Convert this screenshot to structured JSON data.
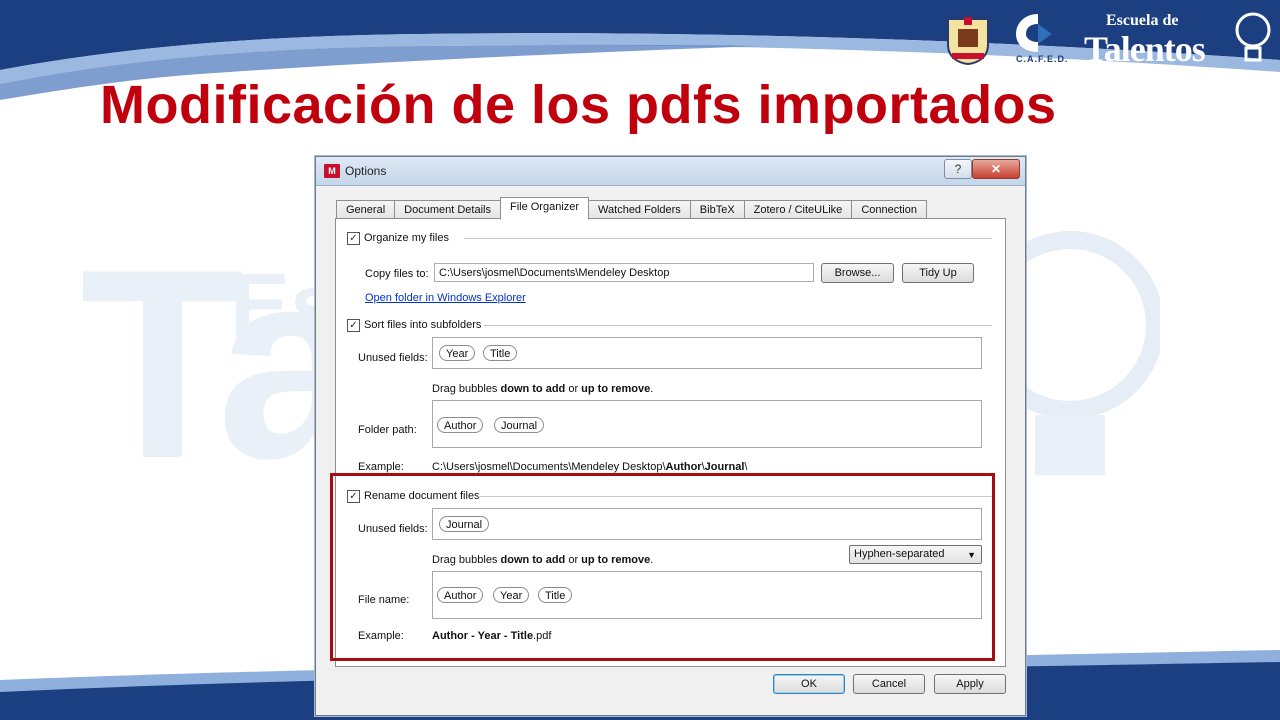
{
  "slide": {
    "title": "Modificación de los pdfs importados",
    "watermark": "Ta",
    "watermark_small": "Es",
    "logos": {
      "cafed_caption": "C.A.F.E.D.",
      "talentos_top": "Escuela de",
      "talentos_main": "Talentos"
    }
  },
  "dialog": {
    "title": "Options",
    "app_icon": "mendeley-icon",
    "help_label": "?",
    "close_label": "✕",
    "tabs": [
      "General",
      "Document Details",
      "File Organizer",
      "Watched Folders",
      "BibTeX",
      "Zotero / CiteULike",
      "Connection"
    ],
    "active_tab": "File Organizer",
    "organize": {
      "checkbox_label": "Organize my files",
      "checked": true,
      "copy_label": "Copy files to:",
      "copy_value": "C:\\Users\\josmel\\Documents\\Mendeley Desktop",
      "browse_label": "Browse...",
      "tidy_label": "Tidy Up",
      "open_folder_link": "Open folder in Windows Explorer"
    },
    "sort": {
      "checkbox_label": "Sort files into subfolders",
      "checked": true,
      "unused_label": "Unused fields:",
      "unused_bubbles": [
        "Year",
        "Title"
      ],
      "drag_hint_pre": "Drag bubbles ",
      "drag_hint_add": "down to add",
      "drag_hint_mid": " or ",
      "drag_hint_remove": "up to remove",
      "drag_hint_end": ".",
      "folder_label": "Folder path:",
      "folder_bubbles": [
        "Author",
        "Journal"
      ],
      "example_label": "Example:",
      "example_prefix": "C:\\Users\\josmel\\Documents\\Mendeley Desktop\\",
      "example_author": "Author",
      "example_sep": "\\",
      "example_journal": "Journal",
      "example_suffix": "\\"
    },
    "rename": {
      "checkbox_label": "Rename document files",
      "checked": true,
      "unused_label": "Unused fields:",
      "unused_bubbles": [
        "Journal"
      ],
      "separator_value": "Hyphen-separated",
      "file_name_label": "File name:",
      "file_bubbles": [
        "Author",
        "Year",
        "Title"
      ],
      "example_label": "Example:",
      "example_bold": "Author - Year - Title",
      "example_ext": ".pdf"
    },
    "buttons": {
      "ok": "OK",
      "cancel": "Cancel",
      "apply": "Apply"
    }
  },
  "colors": {
    "title_red": "#c0000c",
    "highlight_red": "#a50d15",
    "brand_blue": "#1a3d7c"
  }
}
